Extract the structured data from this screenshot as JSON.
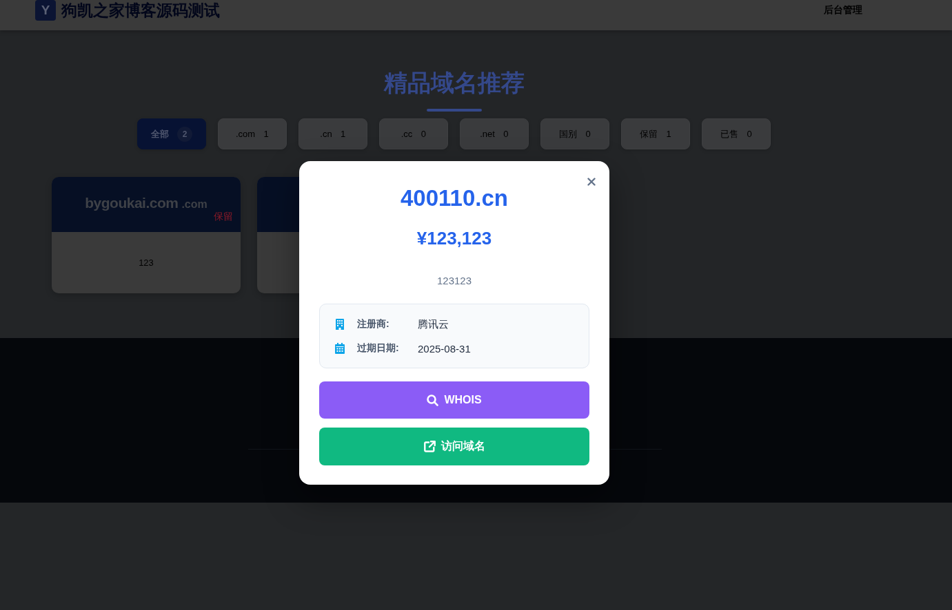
{
  "header": {
    "logo_letter": "Y",
    "site_title": "狗凯之家博客源码测试",
    "nav_link": "后台管理"
  },
  "section": {
    "title": "精品域名推荐",
    "filters": [
      {
        "label": "全部",
        "count": "2",
        "selected": true
      },
      {
        "label": ".com",
        "count": "1",
        "selected": false
      },
      {
        "label": ".cn",
        "count": "1",
        "selected": false
      },
      {
        "label": ".cc",
        "count": "0",
        "selected": false
      },
      {
        "label": ".net",
        "count": "0",
        "selected": false
      },
      {
        "label": "国别",
        "count": "0",
        "selected": false
      },
      {
        "label": "保留",
        "count": "1",
        "selected": false
      },
      {
        "label": "已售",
        "count": "0",
        "selected": false
      }
    ]
  },
  "cards": [
    {
      "domain": "bygoukai.com",
      "suffix": ".com",
      "tag": "保留",
      "description": "123"
    }
  ],
  "modal": {
    "domain": "400110.cn",
    "price": "¥123,123",
    "description": "123123",
    "details": [
      {
        "kind": "registrar",
        "label": "注册商:",
        "value": "腾讯云"
      },
      {
        "kind": "expiry",
        "label": "过期日期:",
        "value": "2025-08-31"
      }
    ],
    "buttons": [
      {
        "kind": "whois",
        "label": "WHOIS"
      },
      {
        "kind": "visit",
        "label": "访问域名"
      }
    ]
  }
}
